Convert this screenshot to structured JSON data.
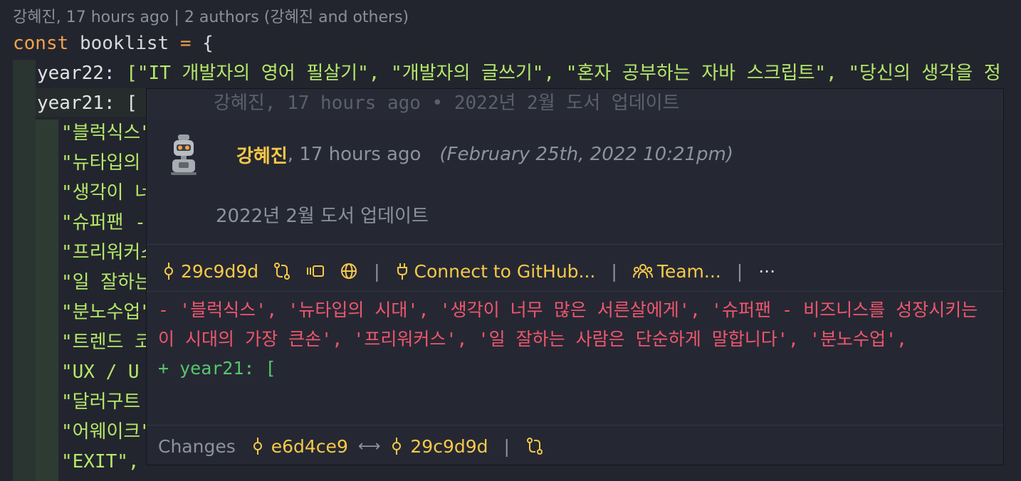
{
  "codelens": "강혜진, 17 hours ago | 2 authors (강혜진 and others)",
  "code": {
    "kw": "const",
    "name": "booklist",
    "eq": "=",
    "brace": "{",
    "year22_key": "year22",
    "colon": ":",
    "year22_value": "[\"IT 개발자의 영어 필살기\", \"개발자의 글쓰기\", \"혼자 공부하는 자바 스크립트\", \"당신의 생각을 정",
    "year21_key": "year21",
    "year21_open": "[",
    "items": [
      "\"블럭식스\"",
      "\"뉴타입의",
      "\"생각이 너",
      "\"슈퍼팬 -",
      "\"프리워커스",
      "\"일 잘하는",
      "\"분노수업\"",
      "\"트렌드 코",
      "\"UX / U",
      "\"달러구트",
      "\"어웨이크\"",
      "\"EXIT\","
    ]
  },
  "inline_blame": "강혜진, 17 hours ago • 2022년 2월 도서 업데이트",
  "hover": {
    "author": "강혜진",
    "relative_time": ", 17 hours ago",
    "date": "(February 25th, 2022 10:21pm)",
    "message": "2022년 2월 도서 업데이트",
    "actions": {
      "sha": "29c9d9d",
      "connect": "Connect to GitHub...",
      "team": "Team...",
      "more": "···",
      "sep": "|"
    },
    "diff": {
      "removed": "- '블럭식스', '뉴타입의 시대', '생각이 너무 많은 서른살에게', '슈퍼팬 - 비즈니스를 성장시키는 이 시대의 가장 큰손', '프리워커스', '일 잘하는 사람은 단순하게 말합니다', '분노수업',",
      "added": "+ year21: ["
    },
    "changes": {
      "label": "Changes",
      "from_sha": "e6d4ce9",
      "to_sha": "29c9d9d",
      "arrow": "⟷",
      "sep": "|"
    }
  },
  "colors": {
    "background": "#23252e",
    "accent": "#f7c948",
    "removed": "#f0566e",
    "added": "#56c76b",
    "string": "#b5e86a",
    "keyword": "#f2a14a"
  }
}
